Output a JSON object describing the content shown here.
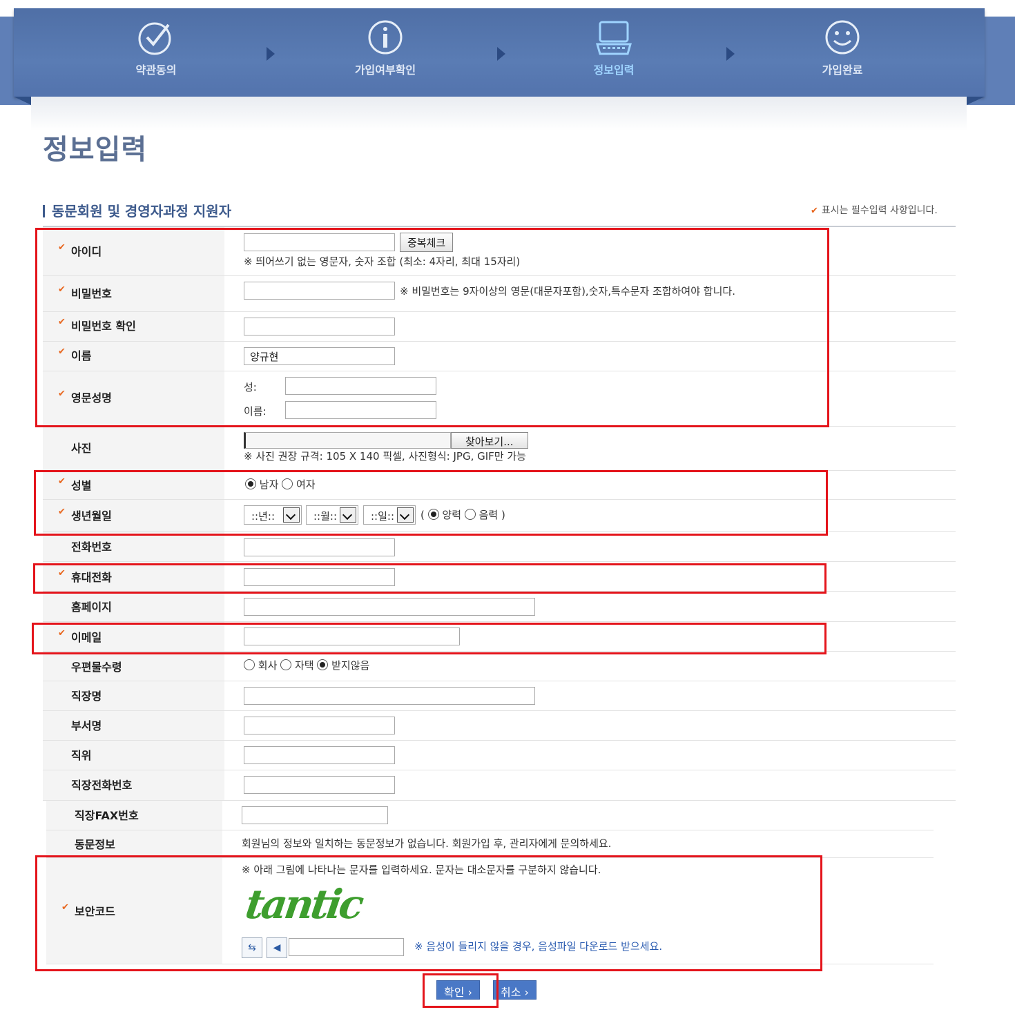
{
  "steps": [
    {
      "label": "약관동의",
      "icon": "check-circle-icon",
      "active": false
    },
    {
      "label": "가입여부확인",
      "icon": "info-circle-icon",
      "active": false
    },
    {
      "label": "정보입력",
      "icon": "laptop-icon",
      "active": true
    },
    {
      "label": "가입완료",
      "icon": "smiley-icon",
      "active": false
    }
  ],
  "page_title": "정보입력",
  "section_title": "동문회원 및 경영자과정 지원자",
  "required_note": "표시는 필수입력 사항입니다.",
  "check_mark": "✔",
  "fields": {
    "id": {
      "label": "아이디",
      "value": "",
      "dup_button": "중복체크",
      "note": "※ 띄어쓰기 없는 영문자, 숫자 조합 (최소: 4자리, 최대 15자리)"
    },
    "password": {
      "label": "비밀번호",
      "value": "",
      "note": "※ 비밀번호는 9자이상의 영문(대문자포함),숫자,특수문자 조합하여야 합니다."
    },
    "password_confirm": {
      "label": "비밀번호 확인",
      "value": ""
    },
    "name": {
      "label": "이름",
      "value": "양규현"
    },
    "english_name": {
      "label": "영문성명",
      "last_label": "성:",
      "first_label": "이름:",
      "last_value": "",
      "first_value": ""
    },
    "photo": {
      "label": "사진",
      "browse_button": "찾아보기...",
      "note": "※ 사진 권장 규격: 105 X 140 픽셀, 사진형식: JPG, GIF만 가능"
    },
    "gender": {
      "label": "성별",
      "options": [
        "남자",
        "여자"
      ],
      "selected": "남자"
    },
    "birth": {
      "label": "생년월일",
      "year": "::년::",
      "month": "::월::",
      "day": "::일::",
      "open_paren": "(",
      "calendar_options": [
        "양력",
        "음력"
      ],
      "selected": "양력",
      "close_paren": ")"
    },
    "phone": {
      "label": "전화번호",
      "value": ""
    },
    "mobile": {
      "label": "휴대전화",
      "value": ""
    },
    "homepage": {
      "label": "홈페이지",
      "value": ""
    },
    "email": {
      "label": "이메일",
      "value": ""
    },
    "mail_receive": {
      "label": "우편물수령",
      "options": [
        "회사",
        "자택",
        "받지않음"
      ],
      "selected": "받지않음"
    },
    "company": {
      "label": "직장명",
      "value": ""
    },
    "department": {
      "label": "부서명",
      "value": ""
    },
    "position": {
      "label": "직위",
      "value": ""
    },
    "work_phone": {
      "label": "직장전화번호",
      "value": ""
    },
    "work_fax": {
      "label": "직장FAX번호",
      "value": ""
    },
    "alumni_info": {
      "label": "동문정보",
      "text": "회원님의 정보와 일치하는 동문정보가 없습니다. 회원가입 후, 관리자에게 문의하세요."
    },
    "security": {
      "label": "보안코드",
      "note": "※ 아래 그림에 나타나는 문자를 입력하세요. 문자는 대소문자를 구분하지 않습니다.",
      "captcha_text": "tantic",
      "refresh_icon": "refresh-icon",
      "audio_icon": "speaker-icon",
      "value": "",
      "audio_note": "※ 음성이 들리지 않을 경우, 음성파일 다운로드 받으세요."
    }
  },
  "buttons": {
    "confirm": "확인 ›",
    "cancel": "취소 ›"
  },
  "colors": {
    "header": "#5373ad",
    "accent_check": "#e8651c",
    "highlight_box": "#e4141b",
    "button": "#4a78c6"
  }
}
